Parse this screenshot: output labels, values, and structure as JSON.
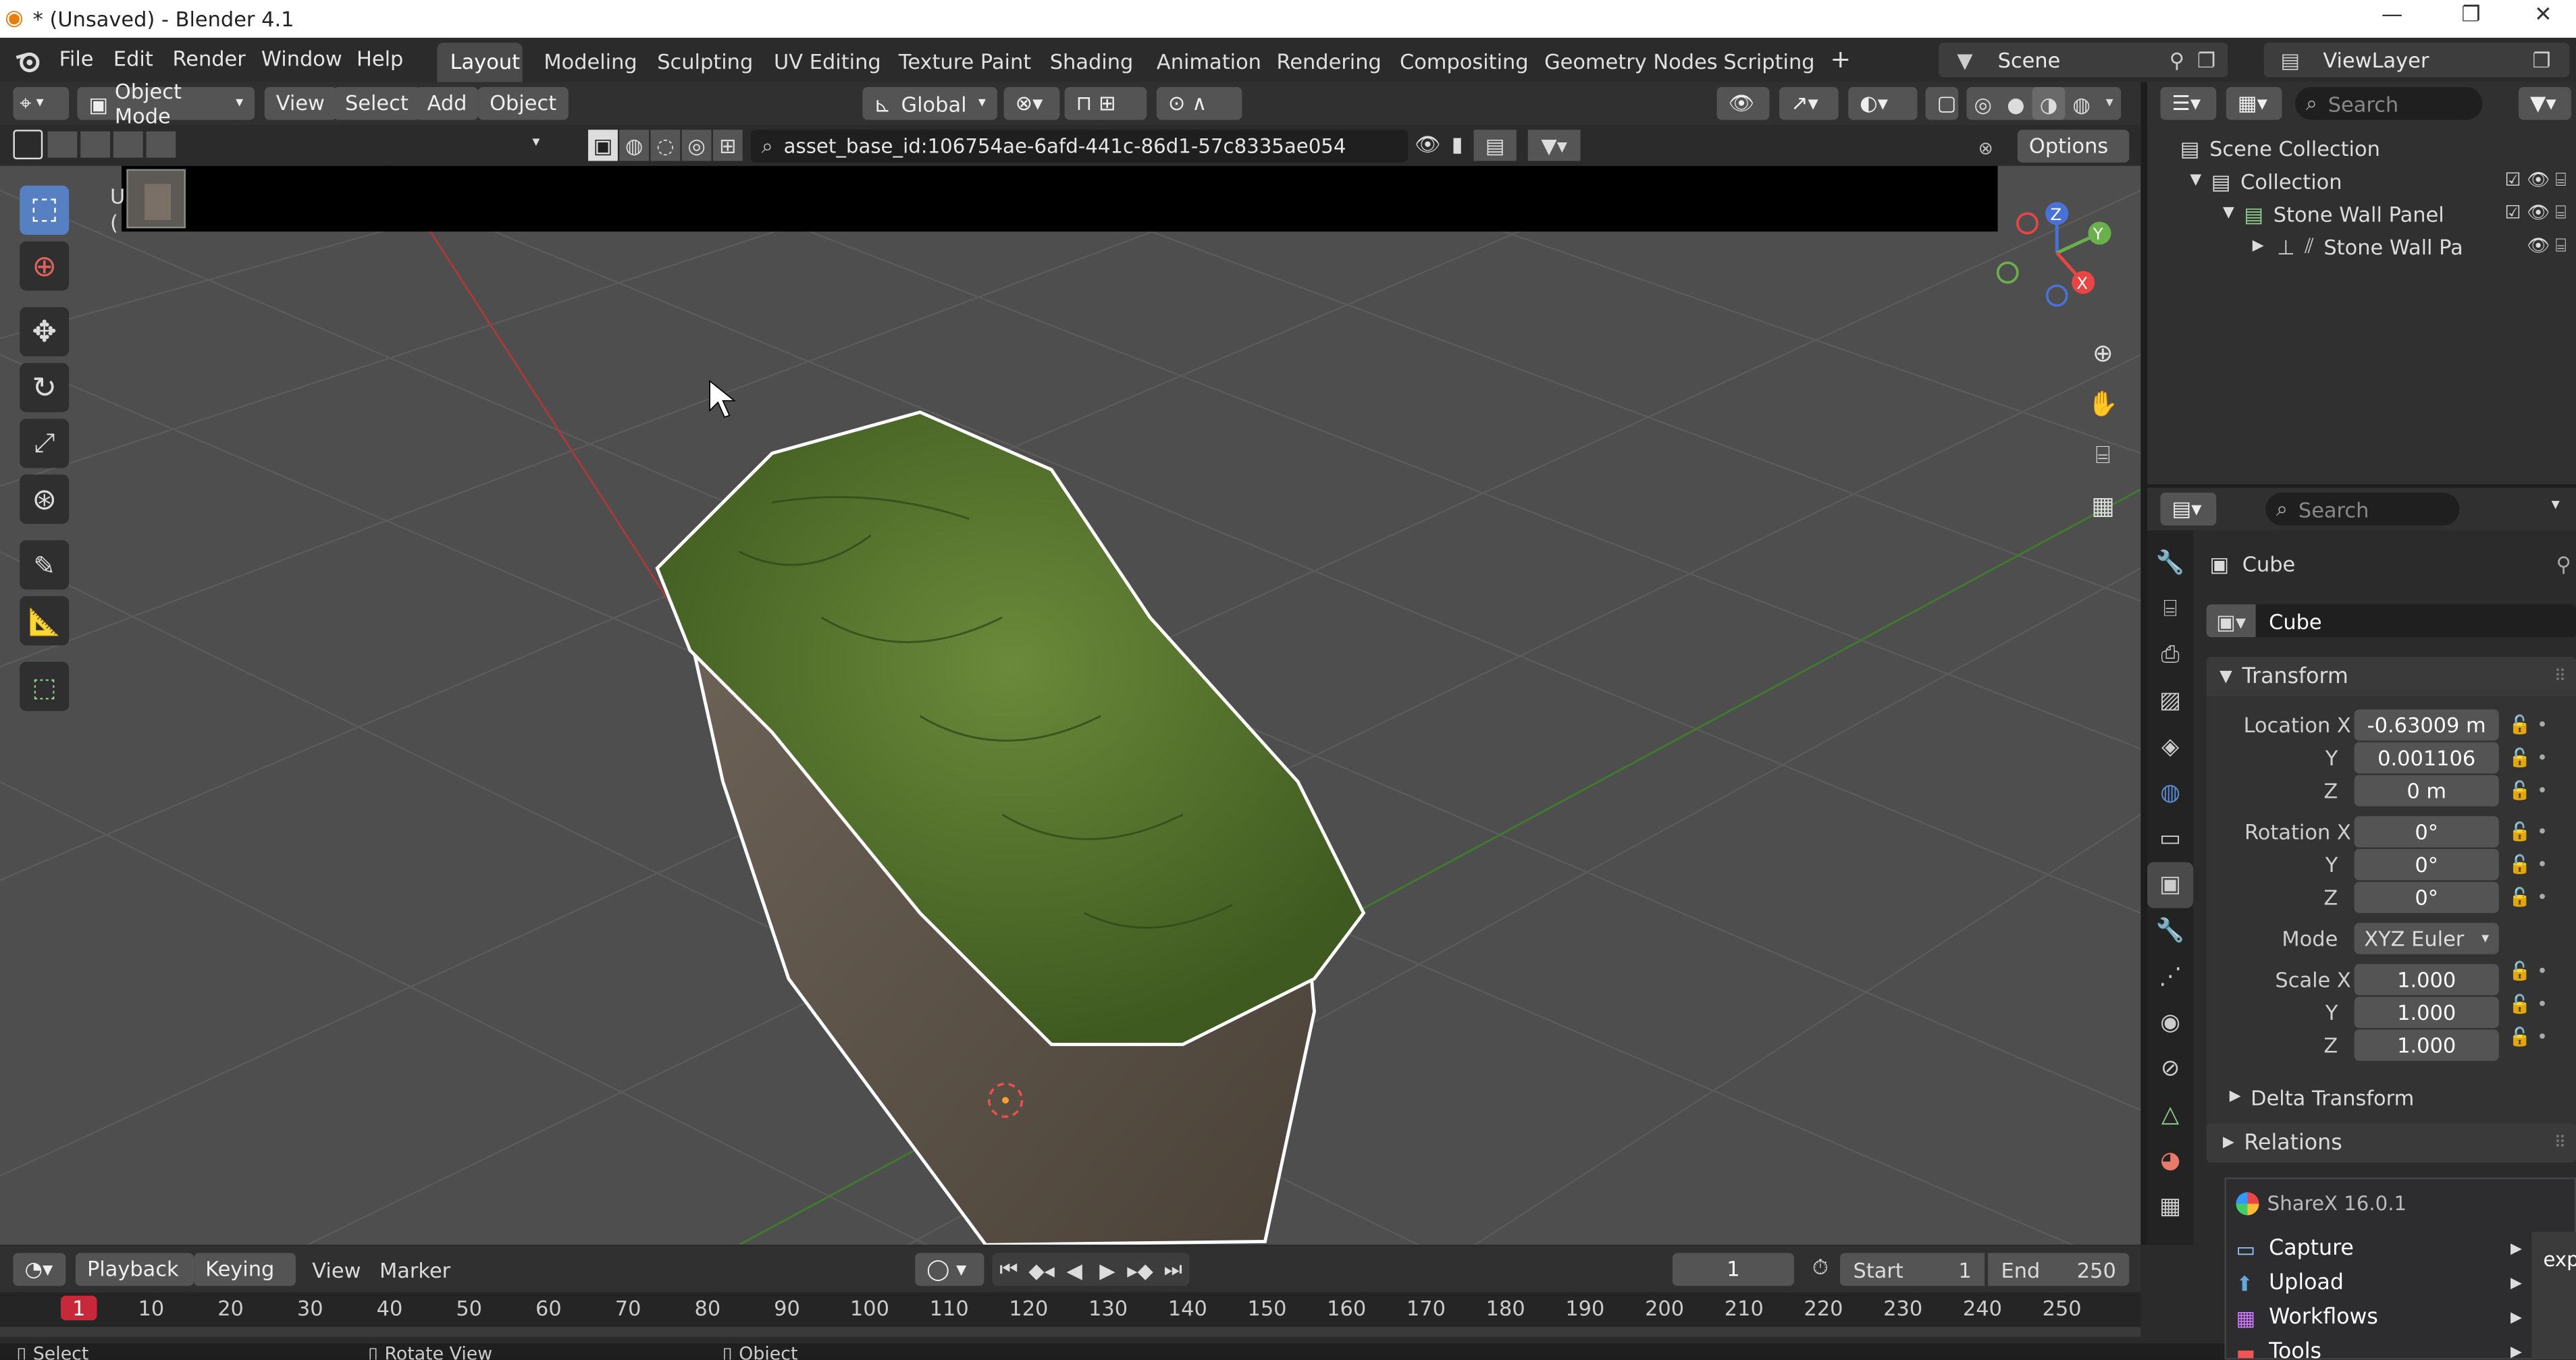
{
  "window": {
    "title": "* (Unsaved) - Blender 4.1",
    "min": "—",
    "max": "❐",
    "close": "✕"
  },
  "menu": [
    "File",
    "Edit",
    "Render",
    "Window",
    "Help"
  ],
  "workspaces": [
    "Layout",
    "Modeling",
    "Sculpting",
    "UV Editing",
    "Texture Paint",
    "Shading",
    "Animation",
    "Rendering",
    "Compositing",
    "Geometry Nodes",
    "Scripting"
  ],
  "workspace_active": "Layout",
  "scene": {
    "name": "Scene",
    "view_layer": "ViewLayer"
  },
  "viewport_header": {
    "mode": "Object Mode",
    "view": "View",
    "select": "Select",
    "add": "Add",
    "object": "Object",
    "orientation": "Global"
  },
  "asset_bar": {
    "search_text": "asset_base_id:106754ae-6afd-441c-86d1-57c8335ae054",
    "options": "Options"
  },
  "viewport_overlay": {
    "line1": "U",
    "line2": "("
  },
  "navigation_gizmo": {
    "z": "Z",
    "y": "Y",
    "x": "X"
  },
  "outliner": {
    "search_placeholder": "Search",
    "items": [
      {
        "label": "Scene Collection"
      },
      {
        "label": "Collection"
      },
      {
        "label": "Stone Wall Panel"
      },
      {
        "label": "Stone Wall Pa"
      }
    ]
  },
  "properties": {
    "search_placeholder": "Search",
    "object_name": "Cube",
    "data_name": "Cube",
    "transform_title": "Transform",
    "location_label": "Location X",
    "location": {
      "x": "-0.63009 m",
      "y": "0.001106",
      "z": "0 m"
    },
    "rotation_label": "Rotation X",
    "rotation": {
      "x": "0°",
      "y": "0°",
      "z": "0°"
    },
    "mode_label": "Mode",
    "mode": "XYZ Euler",
    "scale_label": "Scale X",
    "scale": {
      "x": "1.000",
      "y": "1.000",
      "z": "1.000"
    },
    "axis_y": "Y",
    "axis_z": "Z",
    "delta_transform": "Delta Transform",
    "relations": "Relations"
  },
  "sharex_menu": {
    "title": "ShareX 16.0.1",
    "items": [
      "Capture",
      "Upload",
      "Workflows",
      "Tools"
    ],
    "side_text": "exp"
  },
  "timeline": {
    "playback": "Playback",
    "keying": "Keying",
    "view": "View",
    "marker": "Marker",
    "current_frame": "1",
    "start_label": "Start",
    "start": "1",
    "end_label": "End",
    "end": "250",
    "ticks": [
      "1",
      "10",
      "20",
      "30",
      "40",
      "50",
      "60",
      "70",
      "80",
      "90",
      "100",
      "110",
      "120",
      "130",
      "140",
      "150",
      "160",
      "170",
      "180",
      "190",
      "200",
      "210",
      "220",
      "230",
      "240",
      "250"
    ]
  },
  "statusbar": {
    "select": "Select",
    "rotate": "Rotate View",
    "object": "Object"
  },
  "colors": {
    "accent": "#5680c2",
    "x_axis": "#e84545",
    "y_axis": "#6ab04c",
    "z_axis": "#4a72d6",
    "frame_marker": "#c8293a"
  }
}
